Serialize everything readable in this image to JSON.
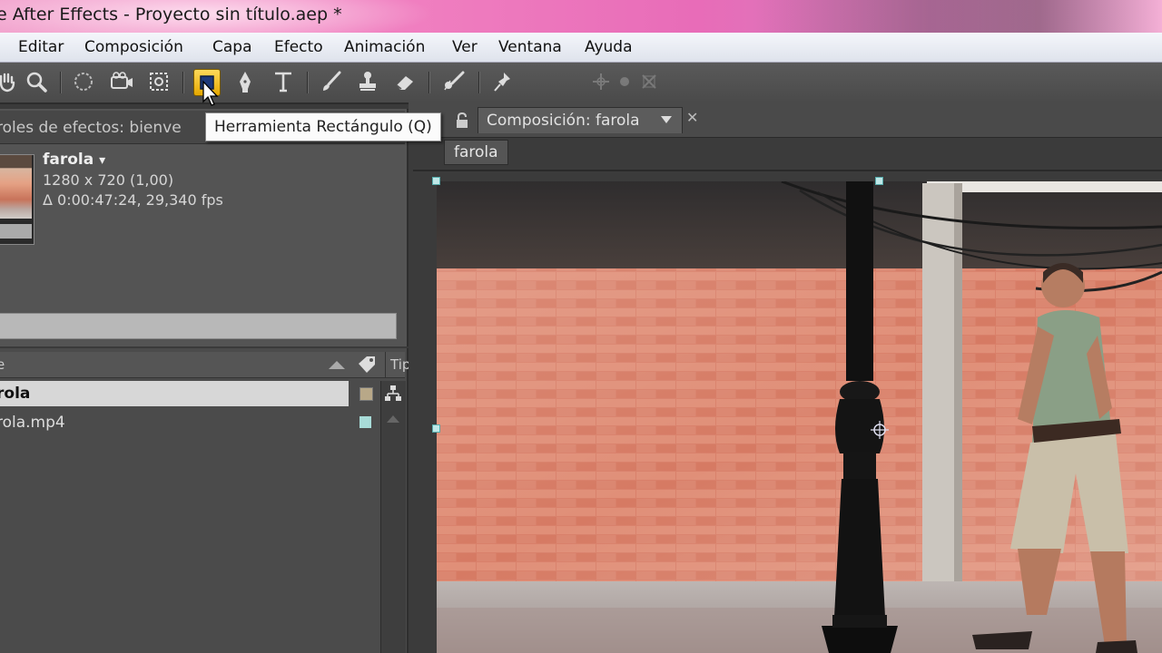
{
  "window": {
    "title": "e After Effects - Proyecto sin título.aep *"
  },
  "menu": [
    "Editar",
    "Composición",
    "Capa",
    "Efecto",
    "Animación",
    "Ver",
    "Ventana",
    "Ayuda"
  ],
  "toolbar": {
    "tools": [
      "hand-tool",
      "zoom-tool",
      "rotate-tool",
      "camera-tool",
      "pan-behind-tool",
      "rectangle-tool",
      "pen-tool",
      "text-tool",
      "brush-tool",
      "clone-stamp-tool",
      "eraser-tool",
      "roto-brush-tool",
      "puppet-pin-tool"
    ],
    "active_tool": "rectangle-tool",
    "active_color": "#f0c020",
    "tooltip": "Herramienta Rectángulo (Q)"
  },
  "effects_panel": {
    "tab_label": "roles de efectos: bienve"
  },
  "project": {
    "item_name": "farola",
    "item_name_suffix": "▾",
    "dimensions": "1280 x 720 (1,00)",
    "duration": "Δ 0:00:47:24, 29,340 fps",
    "columns": {
      "name": "e",
      "type": "Tip"
    },
    "items": [
      {
        "name": "rola",
        "label_color": "#b8a888",
        "selected": true
      },
      {
        "name": "rola.mp4",
        "label_color": "#a8dcd8",
        "selected": false
      }
    ]
  },
  "composition": {
    "tab_label": "Composición: farola",
    "breadcrumb": "farola"
  },
  "colors": {
    "title_bar": "#f07fc0",
    "panel_bg": "#545454",
    "accent_handles": "#bfe8e8"
  }
}
